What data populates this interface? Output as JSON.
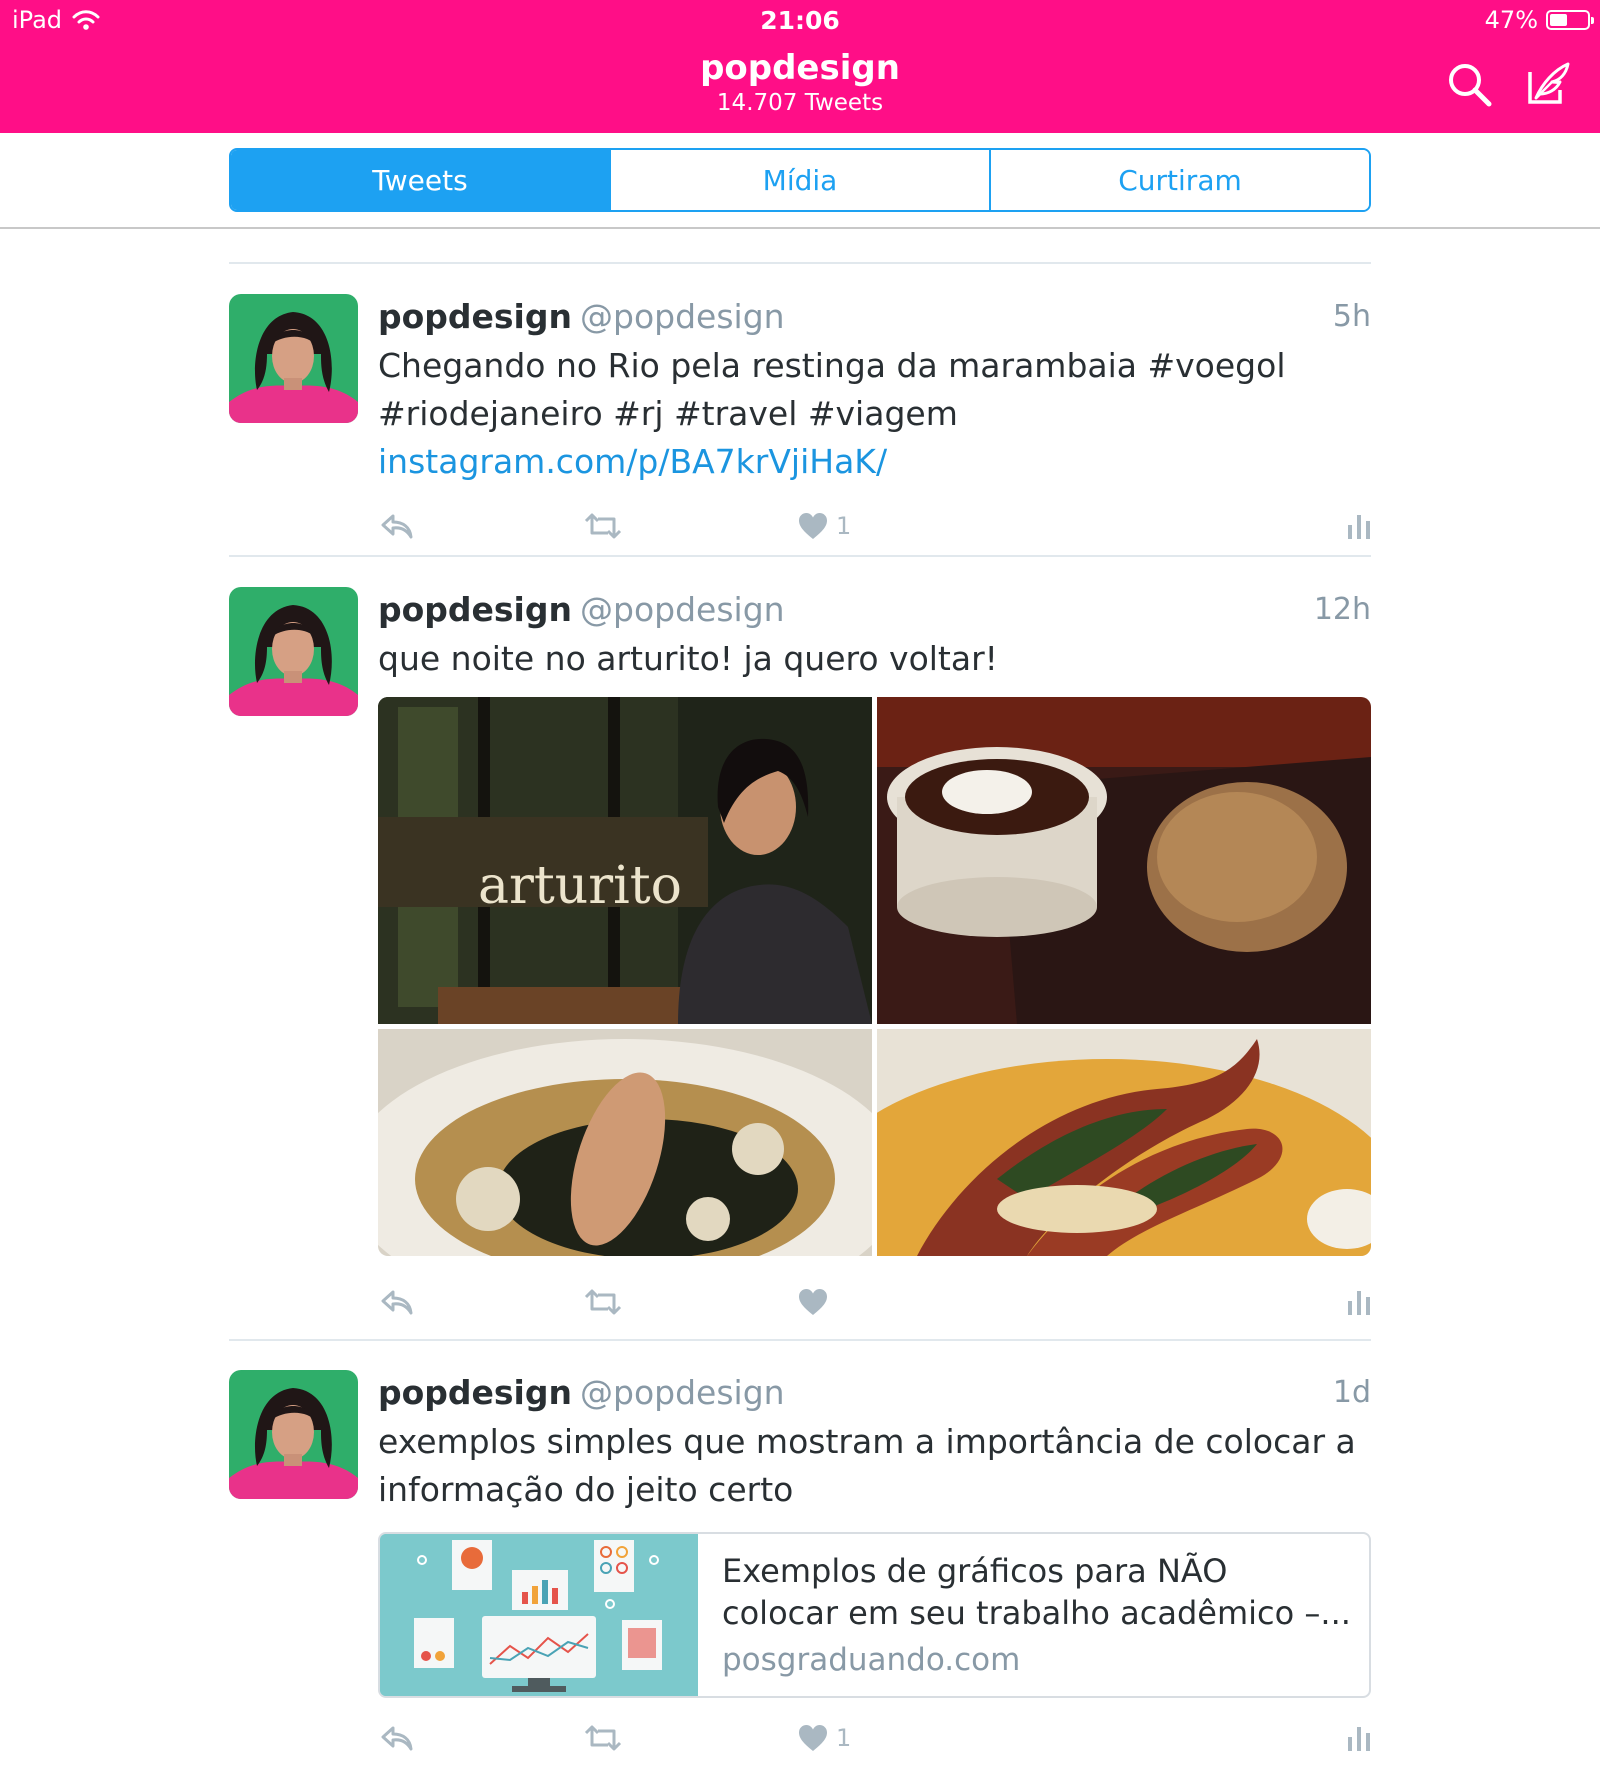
{
  "status_bar": {
    "device": "iPad",
    "time": "21:06",
    "battery": "47%",
    "battery_level": 0.47
  },
  "header": {
    "title": "popdesign",
    "subtitle": "14.707 Tweets",
    "search_icon": "search-icon",
    "compose_icon": "compose-icon"
  },
  "tabs": [
    {
      "label": "Tweets",
      "active": true
    },
    {
      "label": "Mídia",
      "active": false
    },
    {
      "label": "Curtiram",
      "active": false
    }
  ],
  "colors": {
    "brand": "#ff0e87",
    "accent": "#1da1f2",
    "link": "#1b95e0",
    "muted": "#8899a6"
  },
  "tweets": [
    {
      "name": "popdesign",
      "handle": "@popdesign",
      "time": "5h",
      "text": "Chegando no Rio pela restinga da marambaia #voegol #riodejaneiro #rj #travel #viagem ",
      "link": "instagram.com/p/BA7krVjiHaK/",
      "likes": "1"
    },
    {
      "name": "popdesign",
      "handle": "@popdesign",
      "time": "12h",
      "text": "que noite no arturito! ja quero voltar!",
      "photo_sign": "arturito",
      "likes": ""
    },
    {
      "name": "popdesign",
      "handle": "@popdesign",
      "time": "1d",
      "text": "exemplos simples que mostram a importância de colocar a informação do jeito certo",
      "card": {
        "title": "Exemplos de gráficos para NÃO colocar em seu trabalho acadêmico –...",
        "domain": "posgraduando.com"
      },
      "likes": "1"
    }
  ]
}
